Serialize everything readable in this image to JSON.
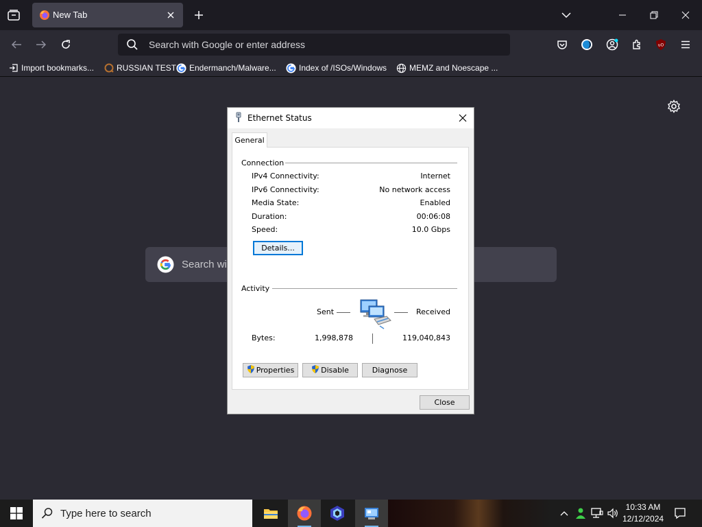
{
  "browser": {
    "tab": {
      "title": "New Tab"
    },
    "urlbar": {
      "placeholder": "Search with Google or enter address"
    },
    "bookmarks": [
      {
        "label": "Import bookmarks...",
        "icon": "import-icon"
      },
      {
        "label": "RUSSIAN TEST",
        "icon": "site-icon"
      },
      {
        "label": "Endermanch/Malware...",
        "icon": "google-icon"
      },
      {
        "label": "Index of /ISOs/Windows",
        "icon": "google-icon"
      },
      {
        "label": "MEMZ and Noescape ...",
        "icon": "globe-icon"
      }
    ],
    "google_search": {
      "placeholder": "Search wi"
    }
  },
  "dialog": {
    "title": "Ethernet Status",
    "tab_label": "General",
    "connection": {
      "heading": "Connection",
      "rows": [
        {
          "label": "IPv4 Connectivity:",
          "value": "Internet"
        },
        {
          "label": "IPv6 Connectivity:",
          "value": "No network access"
        },
        {
          "label": "Media State:",
          "value": "Enabled"
        },
        {
          "label": "Duration:",
          "value": "00:06:08"
        },
        {
          "label": "Speed:",
          "value": "10.0 Gbps"
        }
      ],
      "details_button": "Details..."
    },
    "activity": {
      "heading": "Activity",
      "sent_label": "Sent",
      "received_label": "Received",
      "bytes_label": "Bytes:",
      "bytes_sent": "1,998,878",
      "bytes_received": "119,040,843"
    },
    "buttons": {
      "properties": "Properties",
      "disable": "Disable",
      "diagnose": "Diagnose",
      "close": "Close"
    }
  },
  "taskbar": {
    "search_placeholder": "Type here to search",
    "clock": {
      "time": "10:33 AM",
      "date": "12/12/2024"
    }
  },
  "colors": {
    "browser_bg": "#2b2a33",
    "tabbar_bg": "#1c1b22",
    "accent": "#0078d7",
    "taskbar_bg": "#1c1c1c"
  }
}
